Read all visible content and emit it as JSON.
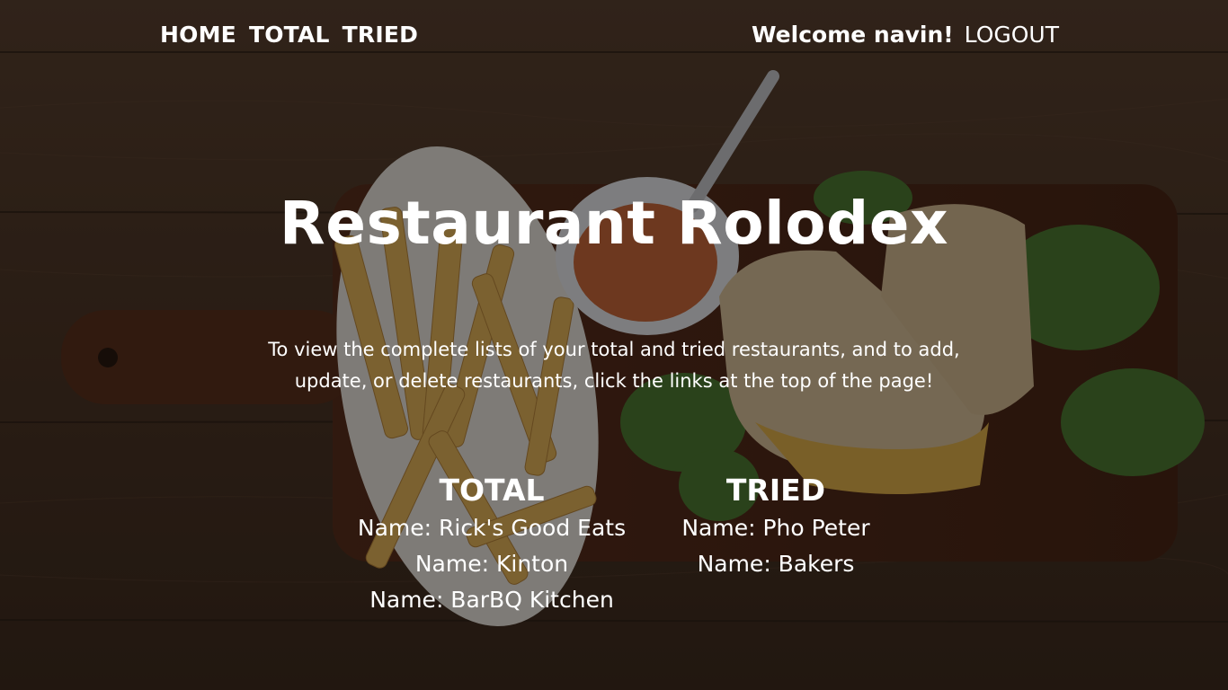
{
  "nav": {
    "links": [
      "HOME",
      "TOTAL",
      "TRIED"
    ],
    "welcome": "Welcome navin!",
    "logout": "LOGOUT"
  },
  "hero": {
    "title": "Restaurant Rolodex",
    "intro": "To view the complete lists of your total and tried restaurants, and to add, update, or delete restaurants, click the links at the top of the page!"
  },
  "lists": {
    "total": {
      "heading": "TOTAL",
      "items": [
        "Name: Rick's Good Eats",
        "Name: Kinton",
        "Name: BarBQ Kitchen"
      ]
    },
    "tried": {
      "heading": "TRIED",
      "items": [
        "Name: Pho Peter",
        "Name: Bakers"
      ]
    }
  },
  "background": {
    "description_icon": "food-photo",
    "colors": {
      "wood": "#4a3527",
      "overlay": "#000000"
    }
  }
}
